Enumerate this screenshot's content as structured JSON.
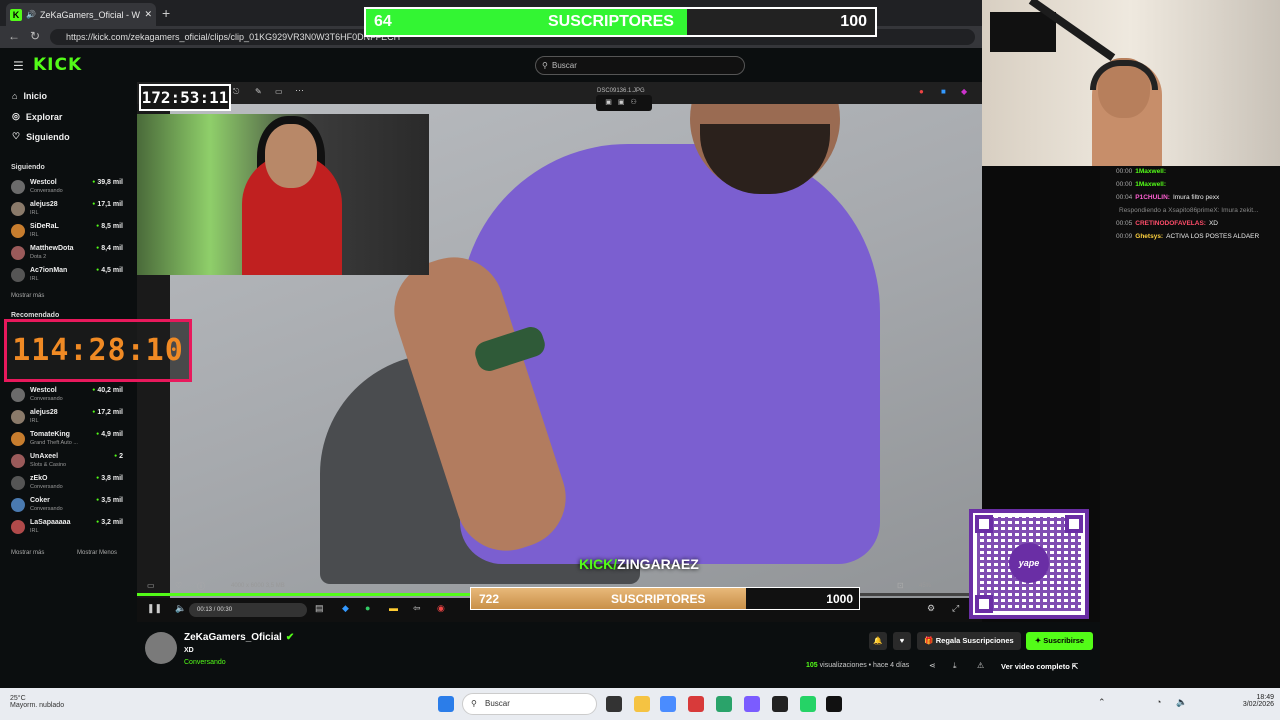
{
  "browser": {
    "tab_title": "ZeKaGamers_Oficial - Watch c",
    "url": "https://kick.com/zekagamers_oficial/clips/clip_01KG929VR3N0W3T6HF0DNFFECH",
    "new_tab_icon": "plus-icon"
  },
  "kick": {
    "logo": "KICK",
    "search_placeholder": "Buscar",
    "nav": [
      {
        "label": "Inicio",
        "icon": "home-icon"
      },
      {
        "label": "Explorar",
        "icon": "compass-icon"
      },
      {
        "label": "Siguiendo",
        "icon": "heart-icon"
      }
    ],
    "following_title": "Siguiendo",
    "following": [
      {
        "name": "Westcol",
        "category": "Conversando",
        "viewers": "39,8 mil"
      },
      {
        "name": "alejus28",
        "category": "IRL",
        "viewers": "17,1 mil"
      },
      {
        "name": "SiDeRaL",
        "category": "IRL",
        "viewers": "8,5 mil"
      },
      {
        "name": "MatthewDota",
        "category": "Dota 2",
        "viewers": "8,4 mil"
      },
      {
        "name": "Ac7ionMan",
        "category": "IRL",
        "viewers": "4,5 mil"
      }
    ],
    "show_more": "Mostrar más",
    "recommended_title": "Recomendado",
    "recommended": [
      {
        "name": "Westcol",
        "category": "Conversando",
        "viewers": "40,2 mil"
      },
      {
        "name": "alejus28",
        "category": "IRL",
        "viewers": "17,2 mil"
      },
      {
        "name": "TomateKing",
        "category": "Grand Theft Auto ...",
        "viewers": "4,9 mil"
      },
      {
        "name": "UnAxeel",
        "category": "Slots & Casino",
        "viewers": "2"
      },
      {
        "name": "zEkO",
        "category": "Conversando",
        "viewers": "3,8 mil"
      },
      {
        "name": "Coker",
        "category": "Conversando",
        "viewers": "3,5 mil"
      },
      {
        "name": "LaSapaaaaa",
        "category": "IRL",
        "viewers": "3,2 mil"
      }
    ],
    "show_more_2": "Mostrar más",
    "show_less": "Mostrar Menos"
  },
  "overlay": {
    "goal_top": {
      "current": "64",
      "label": "SUSCRIPTORES",
      "target": "100"
    },
    "goal_bottom": {
      "current": "722",
      "label": "SUSCRIPTORES",
      "target": "1000"
    },
    "timer_small": "172:53:11",
    "timer_big": "114:28:10",
    "watermark_prefix": "KICK/",
    "watermark_name": "ZINGARAEZ",
    "qr_logo": "yape"
  },
  "viewer": {
    "file_name": "DSC09136.1.JPG",
    "image_info": "4000 x 6000   3,5 MB",
    "zoom": "45%"
  },
  "player": {
    "time": "00:13 / 00:30"
  },
  "chat": [
    {
      "time": "00:00",
      "user": "1Maxwell:",
      "text": "",
      "color": "#53fc18"
    },
    {
      "time": "00:00",
      "user": "1Maxwell:",
      "text": "",
      "color": "#53fc18"
    },
    {
      "time": "00:04",
      "user": "P1CHULIN:",
      "text": "Imura filtro pexx",
      "color": "#ff5fd2"
    },
    {
      "time": "",
      "user": "",
      "text": "Respondiendo a Xsapito86primeX: Imura zekit...",
      "color": "#888"
    },
    {
      "time": "00:05",
      "user": "CRETINODOFAVELAS:",
      "text": "XD",
      "color": "#ff4d6a"
    },
    {
      "time": "00:09",
      "user": "Ghetsys:",
      "text": "ACTIVA LOS POSTES ALDAER",
      "color": "#ffd23f"
    }
  ],
  "channel": {
    "name": "ZeKaGamers_Oficial",
    "title": "XD",
    "category": "Conversando",
    "gift_label": "Regala Suscripciones",
    "subscribe_label": "Suscribirse",
    "views": "105",
    "views_suffix": "visualizaciones • hace 4 días",
    "full_video": "Ver video completo"
  },
  "taskbar": {
    "temp": "25°C",
    "weather": "Mayorm. nublado",
    "search": "Buscar",
    "time": "18:49",
    "date": "3/02/2026"
  }
}
